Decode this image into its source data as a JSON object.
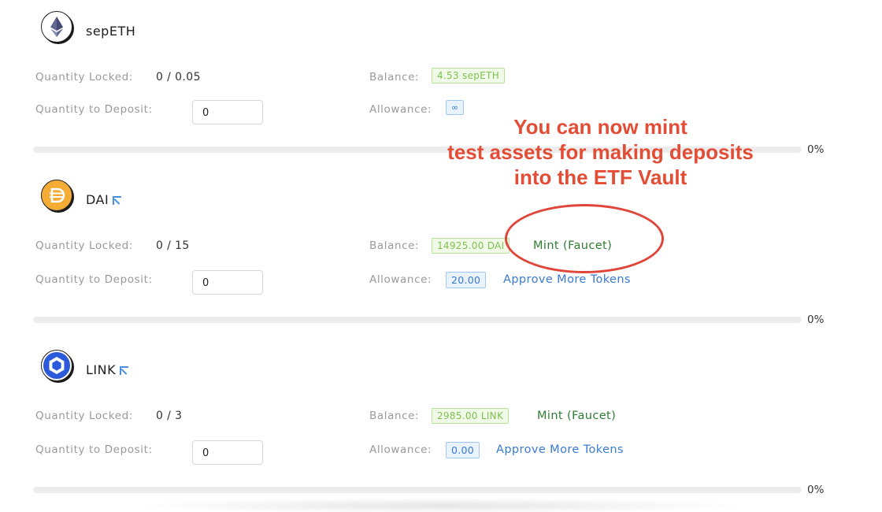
{
  "labels": {
    "quantity_locked": "Quantity Locked:",
    "quantity_to_deposit": "Quantity to Deposit:",
    "balance": "Balance:",
    "allowance": "Allowance:"
  },
  "assets": [
    {
      "name": "sepETH",
      "icon": "ethereum-icon",
      "quantity_locked": "0 / 0.05",
      "deposit_value": "0",
      "balance": "4.53 sepETH",
      "allowance": "∞",
      "mint_label": "",
      "approve_label": "",
      "progress_percent": 0,
      "progress_text": "0%"
    },
    {
      "name": "DAI",
      "icon": "dai-icon",
      "quantity_locked": "0 / 15",
      "deposit_value": "0",
      "balance": "14925.00 DAI",
      "allowance": "20.00",
      "mint_label": "Mint (Faucet)",
      "approve_label": "Approve More Tokens",
      "progress_percent": 0,
      "progress_text": "0%"
    },
    {
      "name": "LINK",
      "icon": "chainlink-icon",
      "quantity_locked": "0 / 3",
      "deposit_value": "0",
      "balance": "2985.00 LINK",
      "allowance": "0.00",
      "mint_label": "Mint (Faucet)",
      "approve_label": "Approve More Tokens",
      "progress_percent": 0,
      "progress_text": "0%"
    }
  ],
  "annotation": {
    "lines": [
      "You can now mint",
      "test assets for making deposits",
      "into the ETF Vault"
    ],
    "color": "#e34c35"
  }
}
